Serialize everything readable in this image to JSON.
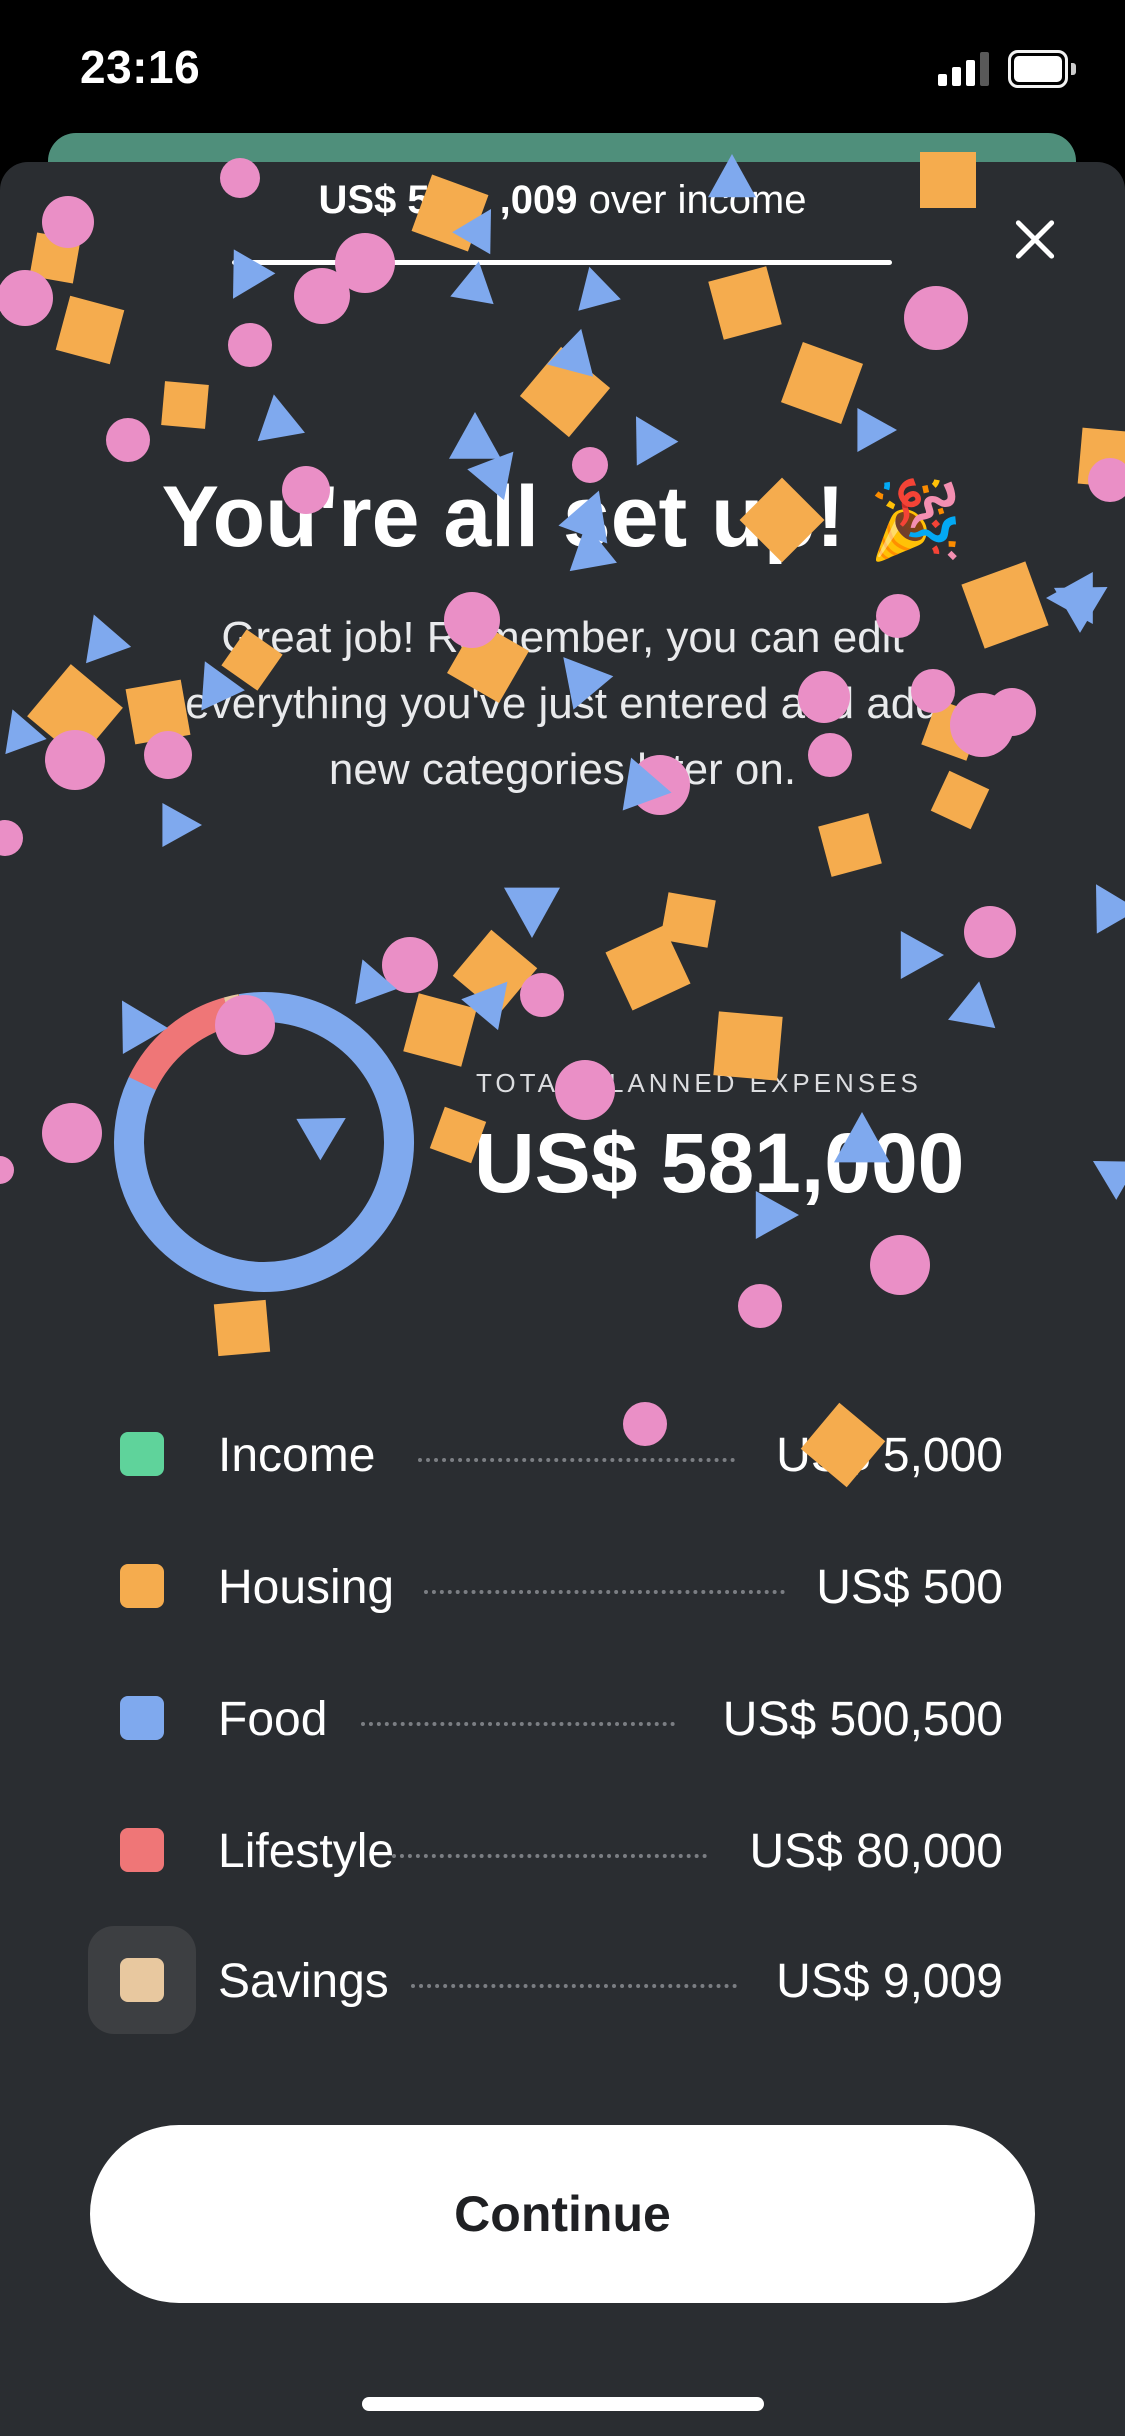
{
  "status_bar": {
    "time": "23:16"
  },
  "header": {
    "progress_amount": "US$ 5",
    "progress_amount_hidden": "",
    "progress_amount_tail": ",009",
    "progress_suffix": " over income",
    "close_icon": "close-icon"
  },
  "hero": {
    "title": "You're all set up!",
    "emoji": "🎉",
    "message": "Great job! Remember, you can edit everything you've just entered and add new categories later on."
  },
  "summary": {
    "total_label": "TOTAL PLANNED EXPENSES",
    "total_value": "US$ 581,000"
  },
  "categories": [
    {
      "name": "Income",
      "amount": "US$ 5,000",
      "color": "#5fd39b",
      "selected": false
    },
    {
      "name": "Housing",
      "amount": "US$ 500",
      "color": "#f5ac4e",
      "selected": false
    },
    {
      "name": "Food",
      "amount": "US$ 500,500",
      "color": "#7fa9ee",
      "selected": false
    },
    {
      "name": "Lifestyle",
      "amount": "US$ 80,000",
      "color": "#ef7677",
      "selected": false
    },
    {
      "name": "Savings",
      "amount": "US$ 9,009",
      "color": "#e8c89f",
      "selected": true
    }
  ],
  "chart_data": {
    "type": "pie",
    "categories": [
      "Housing",
      "Food",
      "Lifestyle",
      "Savings"
    ],
    "values": [
      500,
      500500,
      80000,
      9009
    ],
    "colors": [
      "#f5ac4e",
      "#7fa9ee",
      "#ef7677",
      "#e8c89f"
    ]
  },
  "cta": {
    "continue_label": "Continue"
  },
  "colors": {
    "sheet_background": "#2a2d31",
    "confetti_orange": "#f5ac4e",
    "confetti_pink": "#ea8fc6",
    "confetti_blue": "#7fa9ee"
  }
}
